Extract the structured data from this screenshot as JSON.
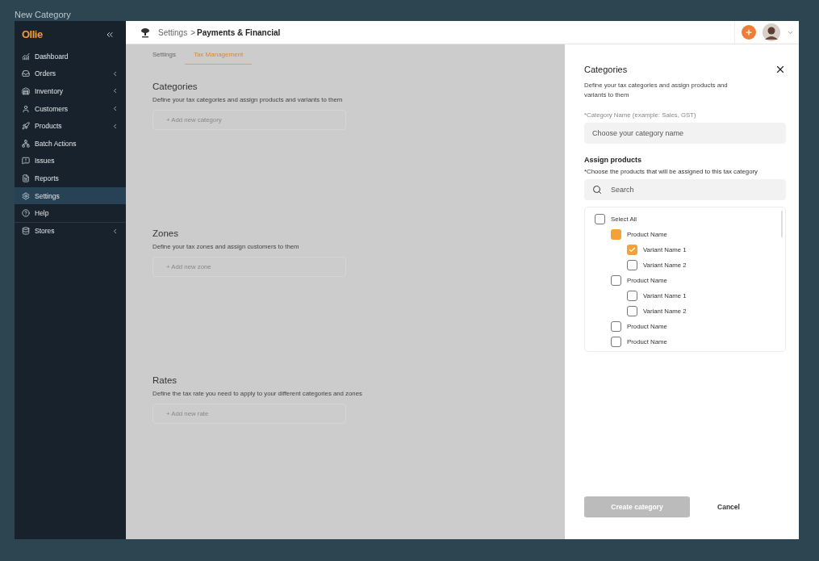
{
  "window": {
    "title": "New Category"
  },
  "sidebar": {
    "logo": "Ollie",
    "items": [
      {
        "label": "Dashboard",
        "selected": false,
        "submenu": false
      },
      {
        "label": "Orders",
        "selected": false,
        "submenu": true
      },
      {
        "label": "Inventory",
        "selected": false,
        "submenu": true
      },
      {
        "label": "Customers",
        "selected": false,
        "submenu": true
      },
      {
        "label": "Products",
        "selected": false,
        "submenu": true
      },
      {
        "label": "Batch Actions",
        "selected": false,
        "submenu": false
      },
      {
        "label": "Issues",
        "selected": false,
        "submenu": false
      },
      {
        "label": "Reports",
        "selected": false,
        "submenu": false
      },
      {
        "label": "Settings",
        "selected": true,
        "submenu": false
      },
      {
        "label": "Help",
        "selected": false,
        "submenu": false
      },
      {
        "label": "Stores",
        "selected": false,
        "submenu": true
      }
    ]
  },
  "header": {
    "breadcrumb": [
      "Settings",
      "Payments & Financial"
    ],
    "separator": ">"
  },
  "tabs": [
    {
      "label": "Settings",
      "selected": false
    },
    {
      "label": "Tax Management",
      "selected": true
    }
  ],
  "sections": [
    {
      "title": "Categories",
      "description": "Define your tax categories and assign products and variants to them",
      "add_label": "+ Add new category"
    },
    {
      "title": "Zones",
      "description": "Define your tax zones and assign customers to them",
      "add_label": "+ Add new zone"
    },
    {
      "title": "Rates",
      "description": "Define the tax rate you need to apply to your different categories and zones",
      "add_label": "+ Add new rate"
    }
  ],
  "drawer": {
    "title": "Categories",
    "description": "Define your tax categories and assign products and variants to them",
    "name_label": "*Category Name (example: Sales, GST)",
    "name_placeholder": "Choose your category name",
    "assign_title": "Assign products",
    "assign_hint": "*Choose the products that will be assigned to this tax category",
    "search": {
      "placeholder": "Search"
    },
    "tree": [
      {
        "label": "Select All",
        "checked": false,
        "partial": false,
        "children": [
          {
            "label": "Product Name",
            "checked": false,
            "partial": true,
            "children": [
              {
                "label": "Variant Name 1",
                "checked": true
              },
              {
                "label": "Variant Name 2",
                "checked": false
              }
            ]
          },
          {
            "label": "Product Name",
            "checked": false,
            "partial": false,
            "children": [
              {
                "label": "Variant Name 1",
                "checked": false
              },
              {
                "label": "Variant Name 2",
                "checked": false
              }
            ]
          },
          {
            "label": "Product Name",
            "checked": false,
            "partial": false
          },
          {
            "label": "Product Name",
            "checked": false,
            "partial": false
          }
        ]
      }
    ],
    "buttons": [
      {
        "label": "Create category",
        "kind": "primary",
        "disabled": true
      },
      {
        "label": "Cancel",
        "kind": "secondary",
        "disabled": false
      }
    ]
  }
}
